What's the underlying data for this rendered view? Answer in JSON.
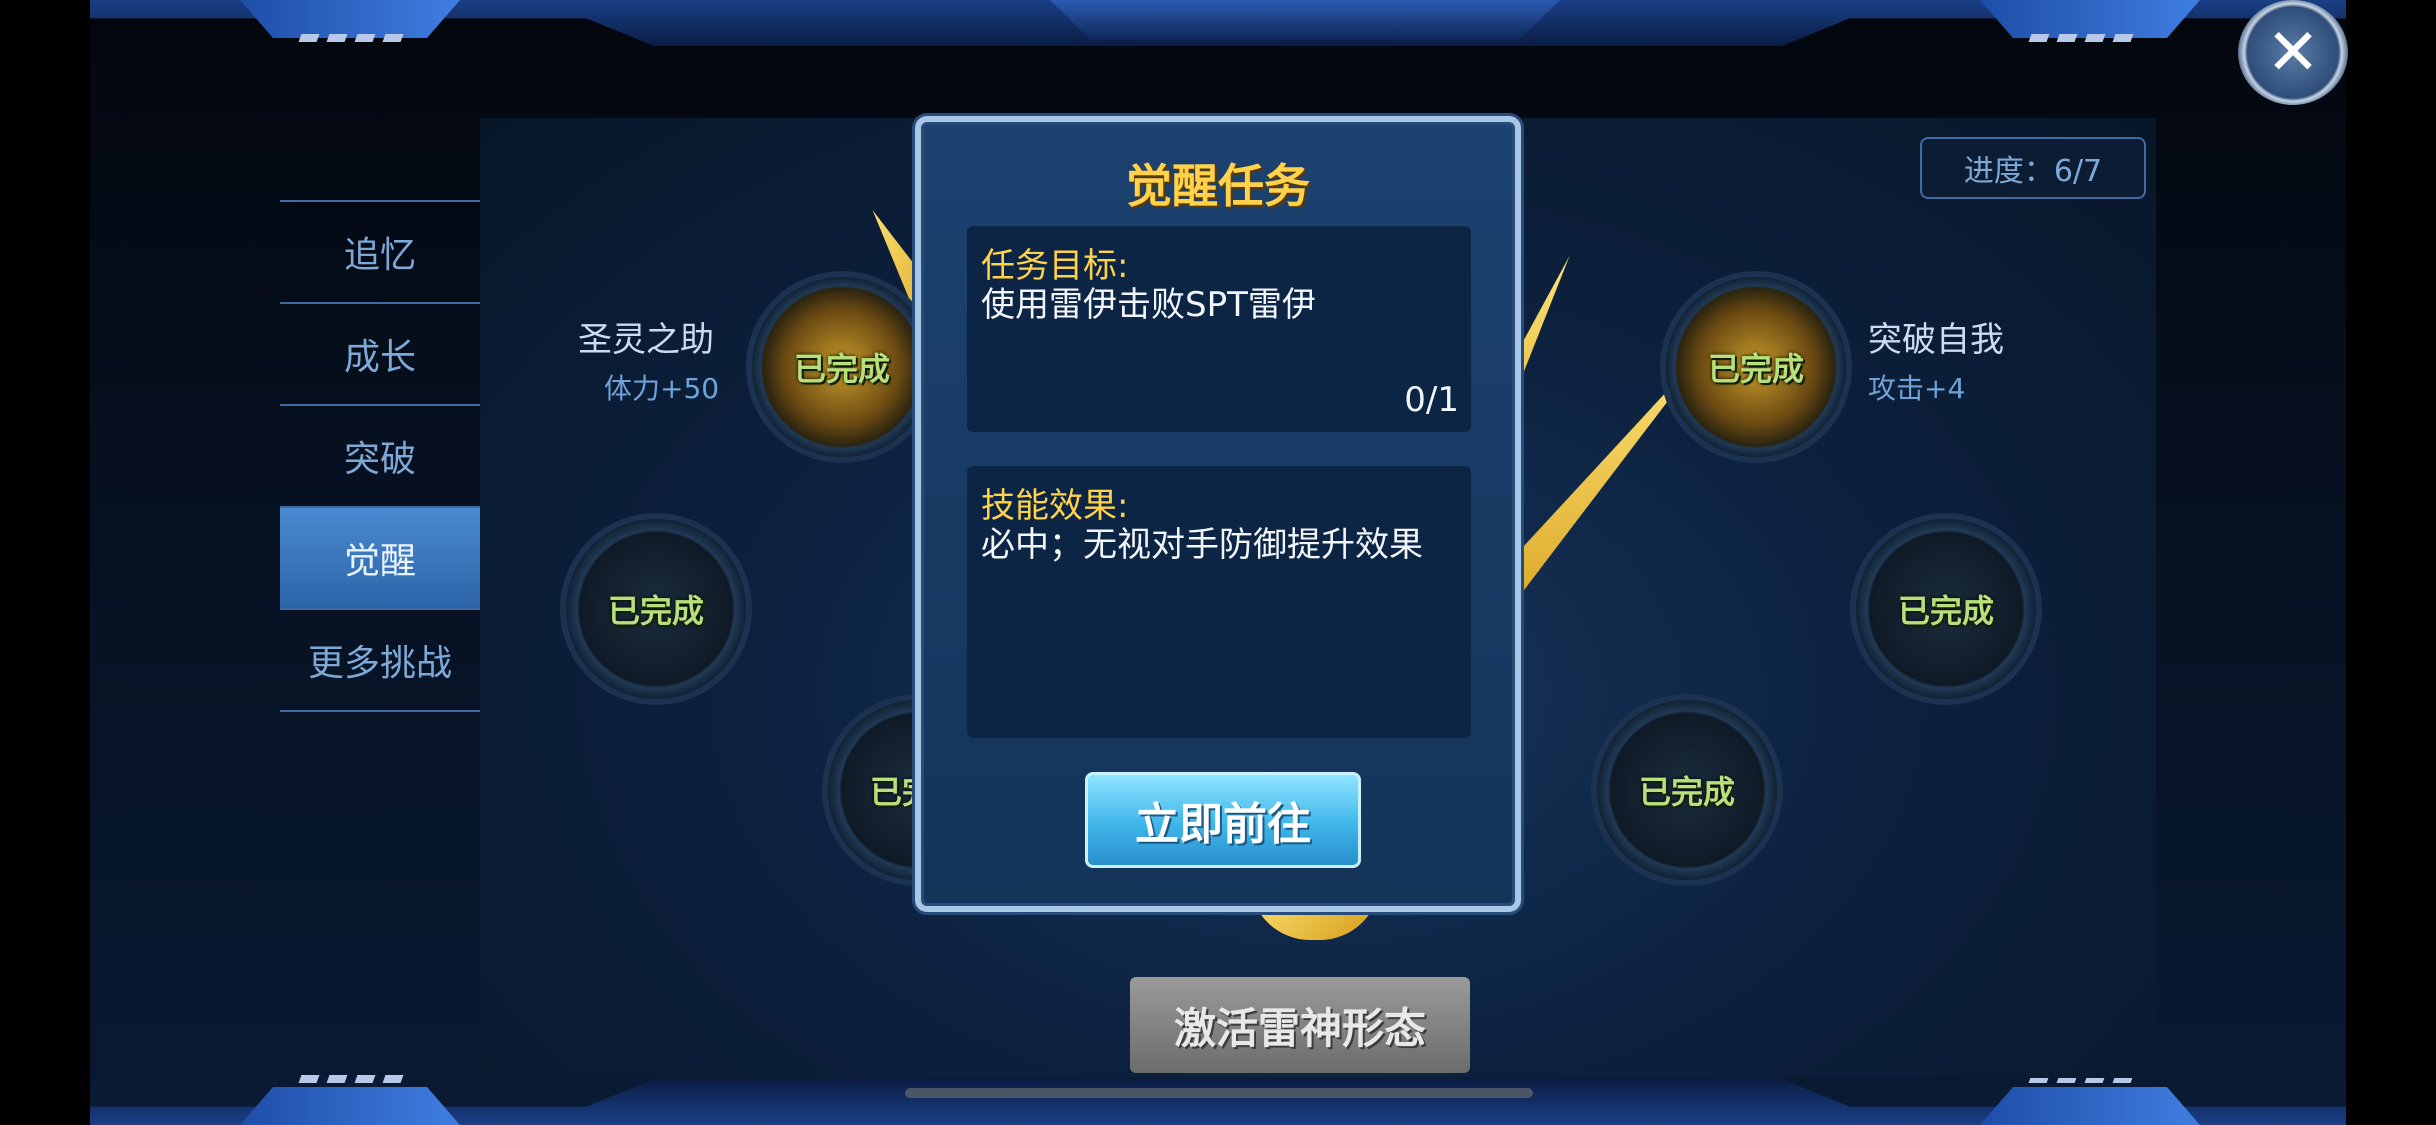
{
  "sidebar": {
    "items": [
      {
        "label": "追忆"
      },
      {
        "label": "成长"
      },
      {
        "label": "突破"
      },
      {
        "label": "觉醒"
      },
      {
        "label": "更多挑战"
      }
    ],
    "active": "觉醒"
  },
  "progress": {
    "label": "进度：6/7"
  },
  "nodes": {
    "done_label": "已完成",
    "top_left": {
      "title": "圣灵之助",
      "bonus": "体力+50"
    },
    "top_right": {
      "title": "突破自我",
      "bonus": "攻击+4"
    }
  },
  "dialog": {
    "title": "觉醒任务",
    "goal_heading": "任务目标:",
    "goal_text": "使用雷伊击败SPT雷伊",
    "goal_count": "0/1",
    "effect_heading": "技能效果:",
    "effect_text": "必中；无视对手防御提升效果",
    "go_button": "立即前往"
  },
  "activate_button": "激活雷神形态",
  "close_icon": "close-icon",
  "colors": {
    "accent_gold": "#ffd24a",
    "done_green": "#b8e07a",
    "dialog_bg": "#1c4270"
  }
}
